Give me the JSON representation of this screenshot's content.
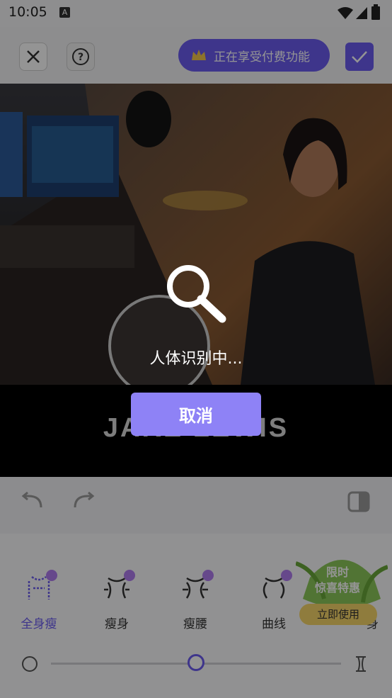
{
  "status_bar": {
    "time": "10:05",
    "notification_badge": "A"
  },
  "header": {
    "premium_label": "正在享受付费功能"
  },
  "photo": {
    "logo_text": "JAKE LEWIS"
  },
  "features": [
    {
      "label": "全身瘦",
      "active": true
    },
    {
      "label": "瘦身",
      "active": false
    },
    {
      "label": "瘦腰",
      "active": false
    },
    {
      "label": "曲线",
      "active": false
    },
    {
      "label": "身",
      "active": false
    }
  ],
  "promo": {
    "title_line1": "限时",
    "title_line2": "惊喜特惠",
    "button": "立即使用"
  },
  "slider": {
    "value_fraction": 0.5
  },
  "overlay": {
    "loading_text": "人体识别中...",
    "cancel_label": "取消"
  },
  "colors": {
    "accent": "#6c5cf0",
    "cancel_button": "#8e82f6",
    "promo": "#7bc34a"
  }
}
